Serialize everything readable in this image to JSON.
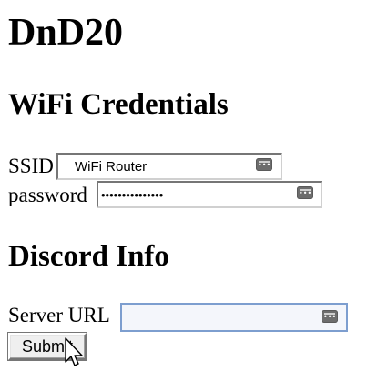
{
  "app": {
    "title": "DnD20"
  },
  "wifi": {
    "section_title": "WiFi Credentials",
    "ssid_label": "SSID",
    "ssid_value": "WiFi Router",
    "password_label": "password",
    "password_mask": "•••••••••••••••"
  },
  "discord": {
    "section_title": "Discord Info",
    "server_url_label": "Server URL",
    "server_url_value": ""
  },
  "form": {
    "submit_label": "Submit"
  },
  "icons": {
    "credential_key": "password-manager-key-icon",
    "pointer": "mouse-pointer-icon"
  },
  "colors": {
    "text": "#000000",
    "background": "#ffffff",
    "focused_border": "#7d9ecf",
    "input_border": "#767676",
    "button_bg": "#efefef"
  }
}
